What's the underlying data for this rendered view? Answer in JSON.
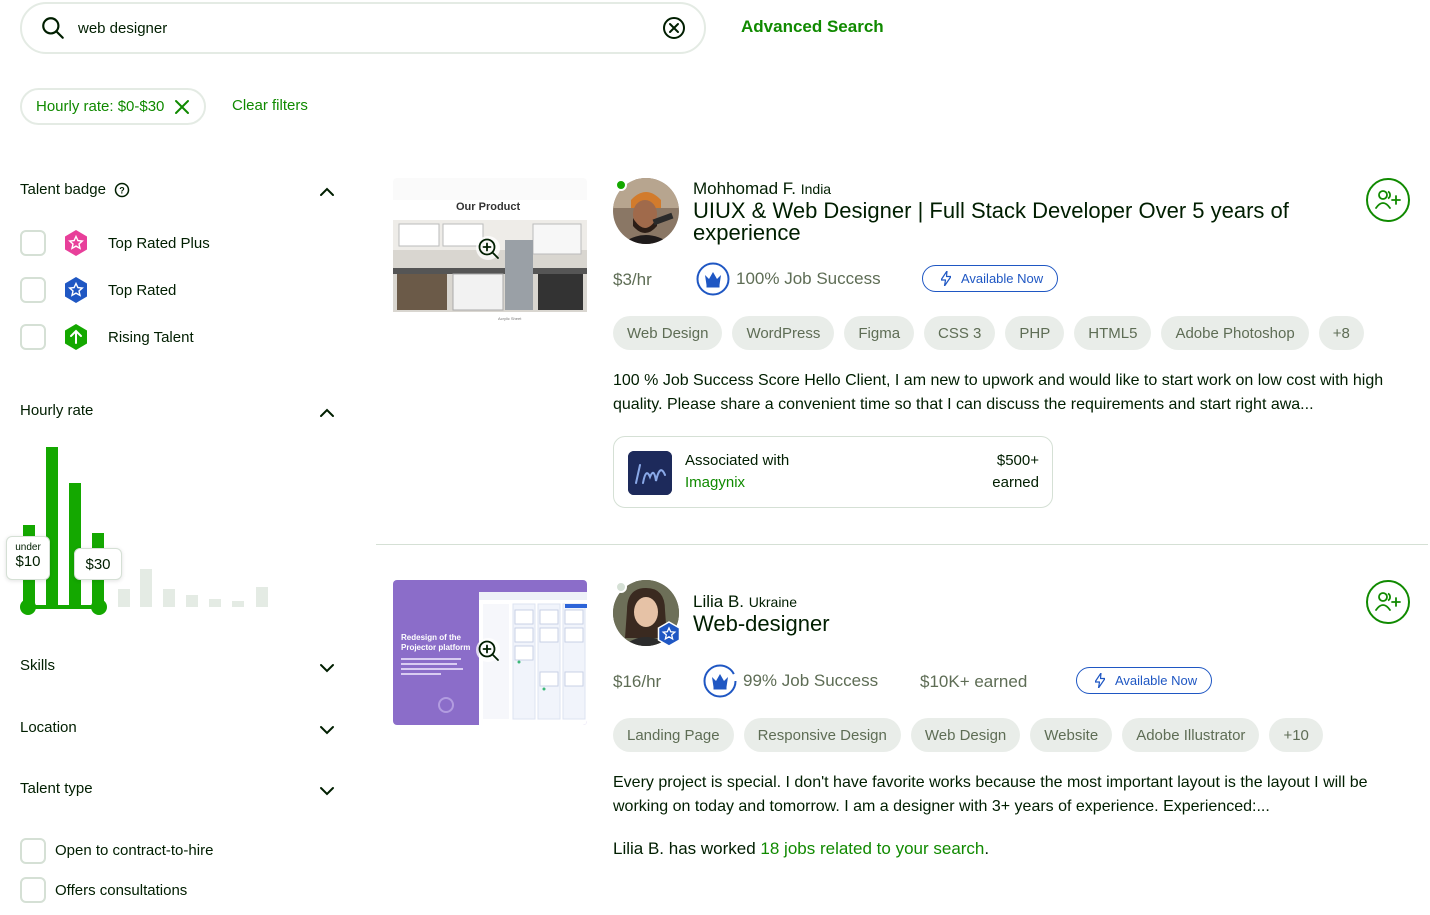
{
  "search": {
    "value": "web designer",
    "advanced_label": "Advanced Search"
  },
  "filters": {
    "active_chip": "Hourly rate: $0-$30",
    "clear_label": "Clear filters"
  },
  "sidebar": {
    "talent_badge": {
      "title": "Talent badge",
      "options": [
        {
          "label": "Top Rated Plus",
          "icon": "top-rated-plus-icon",
          "color": "#e83f9a"
        },
        {
          "label": "Top Rated",
          "icon": "top-rated-icon",
          "color": "#1f57c3"
        },
        {
          "label": "Rising Talent",
          "icon": "rising-talent-icon",
          "color": "#14a800"
        }
      ]
    },
    "hourly_rate": {
      "title": "Hourly rate",
      "min_tip": {
        "prefix": "under",
        "value": "$10"
      },
      "max_tip": {
        "value": "$30"
      }
    },
    "skills_title": "Skills",
    "location_title": "Location",
    "talent_type_title": "Talent type",
    "checkboxes": [
      "Open to contract-to-hire",
      "Offers consultations"
    ]
  },
  "results": [
    {
      "name": "Mohhomad F.",
      "country": "India",
      "title": "UIUX & Web Designer | Full Stack Developer Over 5 years of experience",
      "rate": "$3/hr",
      "job_success": "100% Job Success",
      "available": "Available Now",
      "online": true,
      "tags": [
        "Web Design",
        "WordPress",
        "Figma",
        "CSS 3",
        "PHP",
        "HTML5",
        "Adobe Photoshop",
        "+8"
      ],
      "description": "100 % Job Success Score Hello Client, I am new to upwork and would like to start work on low cost with high quality. Please share a convenient time so that I can discuss the requirements and start right awa...",
      "thumb_text": "Our Product",
      "thumb_sub": "Acrylic Sheet",
      "assoc": {
        "label": "Associated with",
        "agency": "Imagynix",
        "amount": "$500+",
        "amount_label": "earned"
      }
    },
    {
      "name": "Lilia B.",
      "country": "Ukraine",
      "title": "Web-designer",
      "rate": "$16/hr",
      "job_success": "99% Job Success",
      "earned": "$10K+ earned",
      "available": "Available Now",
      "online": false,
      "tags": [
        "Landing Page",
        "Responsive Design",
        "Web Design",
        "Website",
        "Adobe Illustrator",
        "+10"
      ],
      "description": "Every project is special. I don't have favorite works because the most important layout is the layout I will be working on today and tomorrow. I am a designer with 3+ years of experience. Experienced:...",
      "thumb_text": "Redesign of the Projector platform",
      "worked_prefix": "Lilia B. has worked",
      "worked_link": "18 jobs related to your search",
      "worked_suffix": "."
    }
  ],
  "colors": {
    "brand_green": "#108a00",
    "accent_green": "#14a800",
    "blue": "#1f57c3"
  }
}
